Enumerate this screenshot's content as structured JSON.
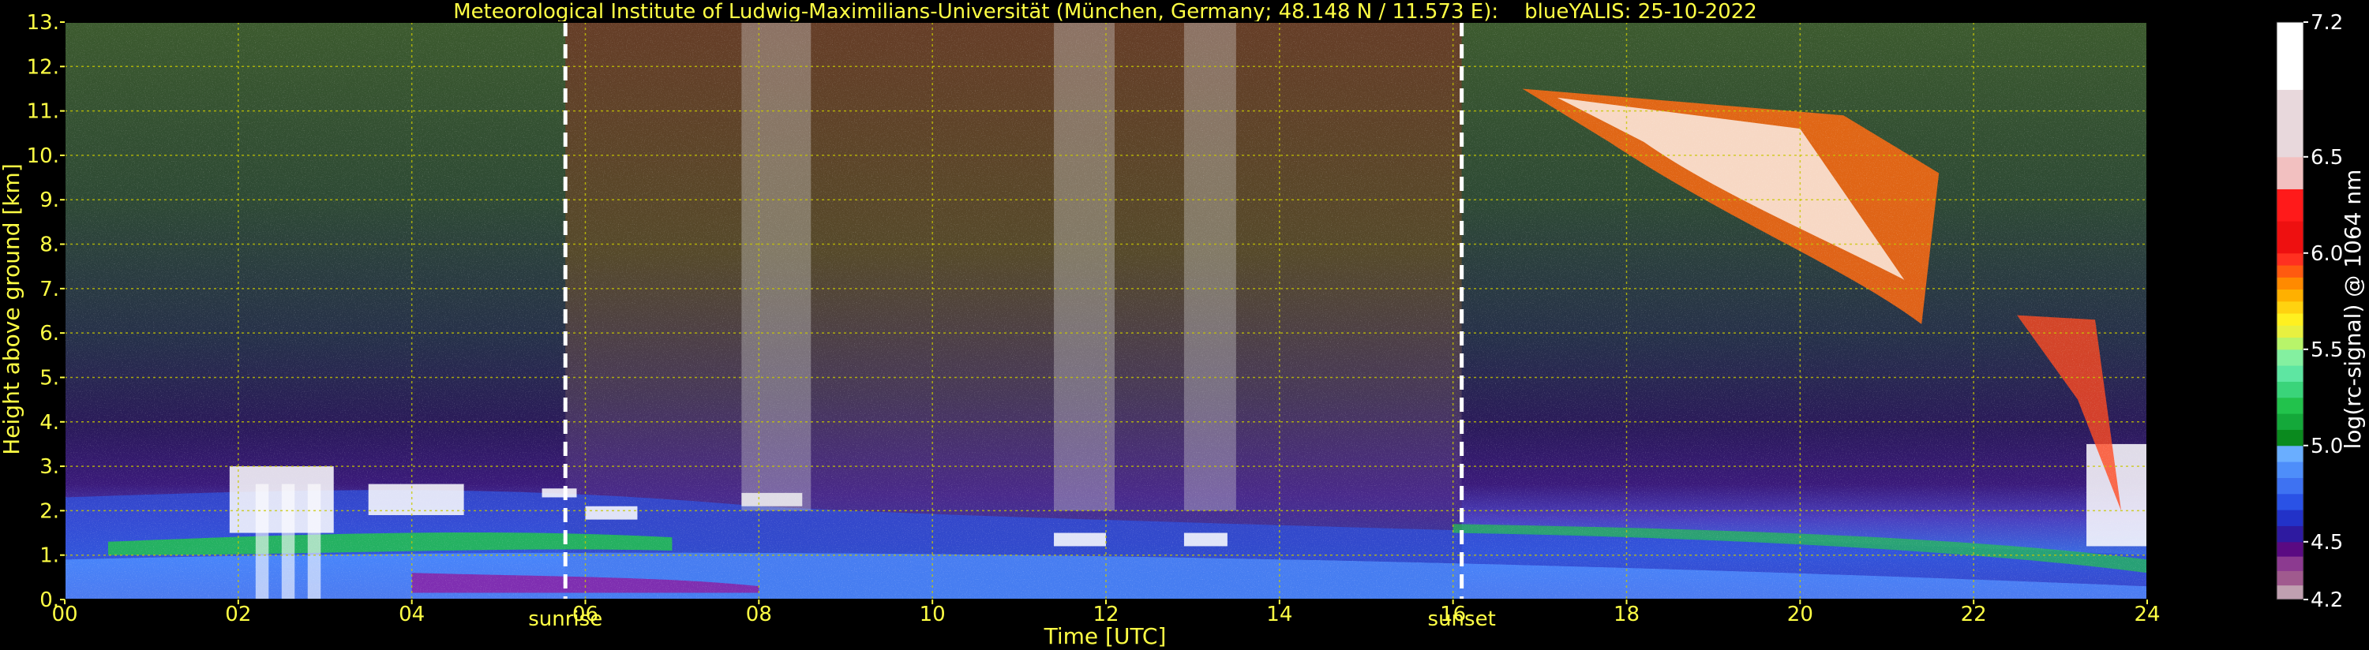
{
  "chart_data": {
    "type": "heatmap",
    "title": "Meteorological Institute of Ludwig-Maximilians-Universität (München, Germany; 48.148 N / 11.573 E):    blueYALIS: 25-10-2022",
    "xlabel": "Time [UTC]",
    "ylabel": "Height above ground [km]",
    "xlim": [
      0,
      24
    ],
    "ylim": [
      0,
      13
    ],
    "x_ticks": [
      "00",
      "02",
      "04",
      "06",
      "08",
      "10",
      "12",
      "14",
      "16",
      "18",
      "20",
      "22",
      "24"
    ],
    "y_ticks": [
      "0.",
      "1.",
      "2.",
      "3.",
      "4.",
      "5.",
      "6.",
      "7.",
      "8.",
      "9.",
      "10.",
      "11.",
      "12.",
      "13."
    ],
    "grid": true,
    "events": [
      {
        "label": "sunrise",
        "x": 5.77
      },
      {
        "label": "sunset",
        "x": 16.1
      }
    ],
    "colorbar": {
      "label": "log(rc-signal) @ 1064 nm",
      "range": [
        4.2,
        7.2
      ],
      "ticks": [
        "4.2",
        "4.5",
        "5.0",
        "5.5",
        "6.0",
        "6.5",
        "7.2"
      ],
      "tick_values": [
        4.2,
        4.5,
        5.0,
        5.5,
        6.0,
        6.5,
        7.2
      ],
      "colors": [
        "#c0a0b0",
        "#a05a8e",
        "#8c3a90",
        "#5a0a82",
        "#2e1aa0",
        "#2232c8",
        "#2a52e6",
        "#3e72f2",
        "#4e8efa",
        "#6aaeff",
        "#0a8a1e",
        "#14a83a",
        "#22c24c",
        "#3ad47a",
        "#5ee6a2",
        "#84f0a0",
        "#b8f46a",
        "#e8f040",
        "#fff020",
        "#ffd210",
        "#ffb000",
        "#ff8a00",
        "#ff5a10",
        "#ff3020",
        "#ee1010",
        "#ff1a1a",
        "#f2c0c0",
        "#e8d8dc",
        "#ffffff"
      ]
    }
  }
}
